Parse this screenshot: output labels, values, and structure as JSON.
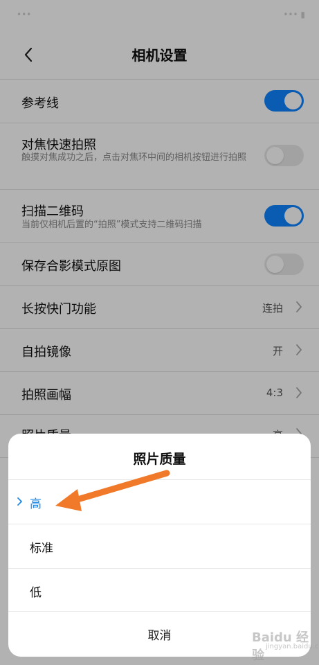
{
  "header": {
    "title": "相机设置"
  },
  "settings": [
    {
      "title": "参考线",
      "control": "toggle",
      "on": true
    },
    {
      "title": "对焦快速拍照",
      "subtitle": "触摸对焦成功之后，点击对焦环中间的相机按钮进行拍照",
      "control": "toggle",
      "on": false
    },
    {
      "title": "扫描二维码",
      "subtitle": "当前仅相机后置的“拍照”模式支持二维码扫描",
      "control": "toggle",
      "on": true
    },
    {
      "title": "保存合影模式原图",
      "control": "toggle",
      "on": false
    },
    {
      "title": "长按快门功能",
      "value": "连拍",
      "control": "chevron"
    },
    {
      "title": "自拍镜像",
      "value": "开",
      "control": "chevron"
    },
    {
      "title": "拍照画幅",
      "value": "4:3",
      "control": "chevron"
    },
    {
      "title": "照片质量",
      "value": "高",
      "control": "chevron"
    }
  ],
  "dialog": {
    "title": "照片质量",
    "options": [
      {
        "label": "高",
        "selected": true
      },
      {
        "label": "标准",
        "selected": false
      },
      {
        "label": "低",
        "selected": false
      }
    ],
    "cancel_label": "取消"
  },
  "watermark": {
    "text": "Baidu 经验",
    "sub": "jingyan.baidu.com"
  },
  "colors": {
    "accent": "#0d84ff",
    "selected_text": "#1e88e5",
    "annotation_arrow": "#f07a2a"
  }
}
